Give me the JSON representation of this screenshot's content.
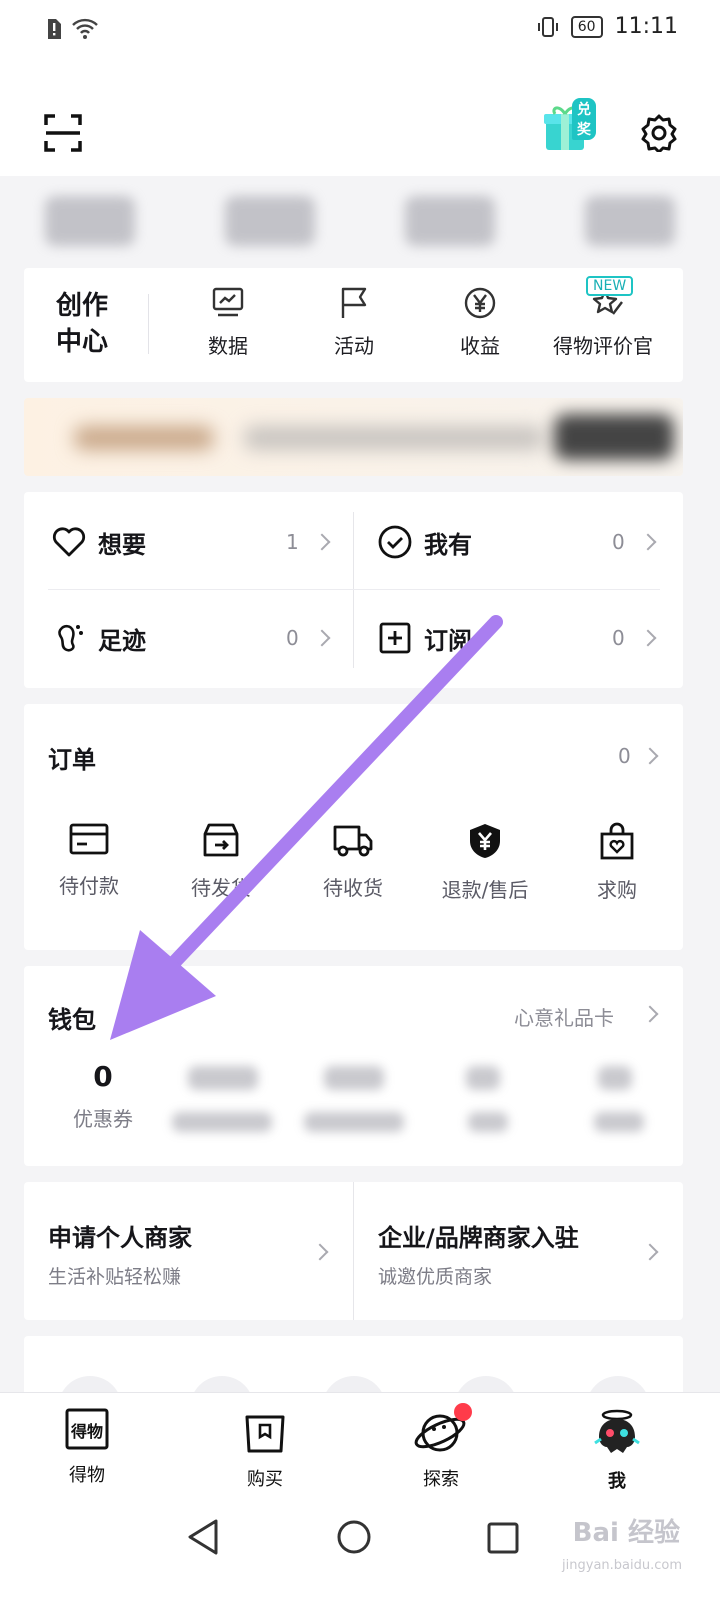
{
  "status_bar": {
    "time": "11:11",
    "battery": "60"
  },
  "header": {
    "scan_icon": "scan-icon",
    "gift_badge": "兑奖",
    "settings_icon": "gear-icon"
  },
  "creator_center": {
    "title": "创作中心",
    "items": [
      {
        "label": "数据",
        "icon": "chart-icon"
      },
      {
        "label": "活动",
        "icon": "flag-icon"
      },
      {
        "label": "收益",
        "icon": "yuan-icon"
      },
      {
        "label": "得物评价官",
        "icon": "pen-star-icon",
        "badge": "NEW"
      }
    ]
  },
  "collection": [
    {
      "label": "想要",
      "count": "1",
      "icon": "heart-icon"
    },
    {
      "label": "我有",
      "count": "0",
      "icon": "check-circle-icon"
    },
    {
      "label": "足迹",
      "count": "0",
      "icon": "footprint-icon"
    },
    {
      "label": "订阅",
      "count": "0",
      "icon": "plus-square-icon"
    }
  ],
  "orders": {
    "title": "订单",
    "count": "0",
    "items": [
      {
        "label": "待付款",
        "icon": "card-icon"
      },
      {
        "label": "待发货",
        "icon": "box-icon"
      },
      {
        "label": "待收货",
        "icon": "truck-icon"
      },
      {
        "label": "退款/售后",
        "icon": "shield-yuan-icon"
      },
      {
        "label": "求购",
        "icon": "bag-heart-icon"
      }
    ]
  },
  "wallet": {
    "title": "钱包",
    "link": "心意礼品卡",
    "coupon_value": "0",
    "coupon_label": "优惠券"
  },
  "merchant": {
    "personal_title": "申请个人商家",
    "personal_sub": "生活补贴轻松赚",
    "brand_title": "企业/品牌商家入驻",
    "brand_sub": "诚邀优质商家"
  },
  "tabs": [
    {
      "label": "得物",
      "icon": "dewu-icon"
    },
    {
      "label": "购买",
      "icon": "shopping-bag-icon"
    },
    {
      "label": "探索",
      "icon": "planet-icon"
    },
    {
      "label": "我",
      "icon": "avatar-icon"
    }
  ],
  "watermark": {
    "main": "Bai 经验",
    "sub": "jingyan.baidu.com"
  },
  "colors": {
    "accent_teal": "#1ec4c4",
    "annotation_arrow": "#a97ef0",
    "badge_red": "#ff3b4a"
  }
}
